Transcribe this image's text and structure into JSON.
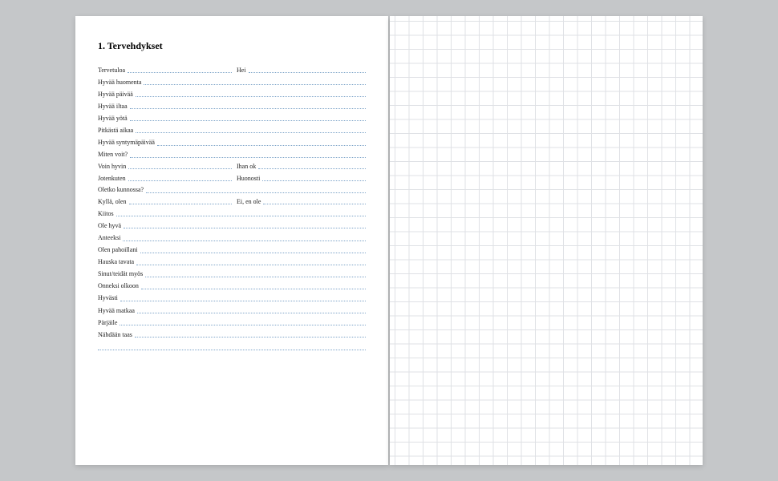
{
  "title": "1. Tervehdykset",
  "rows": [
    {
      "type": "pair",
      "a": "Tervetuloa",
      "b": "Hei"
    },
    {
      "type": "single",
      "label": "Hyvää huomenta"
    },
    {
      "type": "single",
      "label": "Hyvää päivää"
    },
    {
      "type": "single",
      "label": "Hyvää iltaa"
    },
    {
      "type": "single",
      "label": "Hyvää yötä"
    },
    {
      "type": "single",
      "label": "Pitkästä aikaa"
    },
    {
      "type": "single",
      "label": "Hyvää syntymäpäivää"
    },
    {
      "type": "single",
      "label": "Miten voit?"
    },
    {
      "type": "pair",
      "a": "Voin hyvin",
      "b": "Ihan ok"
    },
    {
      "type": "pair",
      "a": "Jotenkuten",
      "b": "Huonosti"
    },
    {
      "type": "single",
      "label": "Oletko kunnossa?"
    },
    {
      "type": "pair",
      "a": "Kyllä, olen",
      "b": "Ei, en ole"
    },
    {
      "type": "single",
      "label": "Kiitos"
    },
    {
      "type": "single",
      "label": "Ole hyvä"
    },
    {
      "type": "single",
      "label": "Anteeksi"
    },
    {
      "type": "single",
      "label": "Olen pahoillani"
    },
    {
      "type": "single",
      "label": "Hauska tavata"
    },
    {
      "type": "single",
      "label": "Sinut/teidät myös"
    },
    {
      "type": "single",
      "label": "Onneksi olkoon"
    },
    {
      "type": "single",
      "label": "Hyvästi"
    },
    {
      "type": "single",
      "label": "Hyvää matkaa"
    },
    {
      "type": "single",
      "label": "Pärjäile"
    },
    {
      "type": "single",
      "label": "Nähdään taas"
    },
    {
      "type": "blank"
    }
  ]
}
